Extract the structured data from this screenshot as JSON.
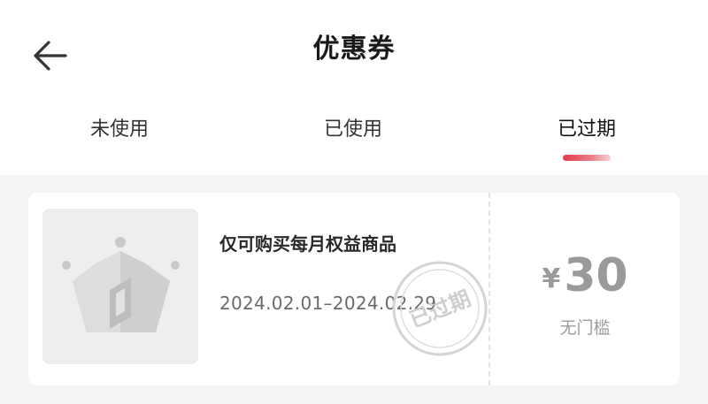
{
  "header": {
    "title": "优惠券",
    "back_icon": "arrow-left-icon"
  },
  "tabs": [
    {
      "label": "未使用",
      "active": false
    },
    {
      "label": "已使用",
      "active": false
    },
    {
      "label": "已过期",
      "active": true
    }
  ],
  "colors": {
    "accent": "#e23a4c",
    "text_primary": "#1a1a1a",
    "text_muted": "#9a9a9a",
    "background": "#f4f4f4"
  },
  "coupons": [
    {
      "thumbnail_icon": "crown-icon",
      "name": "仅可购买每月权益商品",
      "date_range": "2024.02.01–2024.02.29",
      "status_stamp": "已过期",
      "currency": "¥",
      "amount": "30",
      "condition": "无门槛"
    }
  ]
}
